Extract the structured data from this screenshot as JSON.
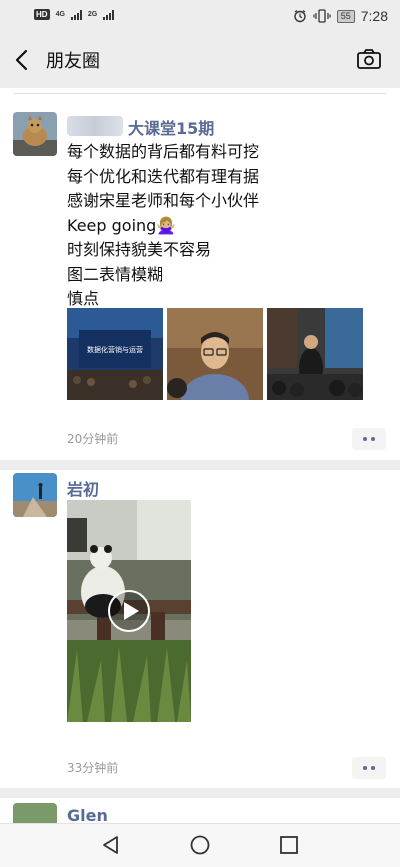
{
  "status_bar": {
    "hd_label": "HD",
    "net_label_1": "4G",
    "net_label_2": "2G",
    "battery": "55",
    "time": "7:28"
  },
  "nav": {
    "title": "朋友圈",
    "back_icon": "chevron-left-icon",
    "camera_icon": "camera-icon"
  },
  "posts": [
    {
      "name": "大课堂15期",
      "text_lines": [
        "每个数据的背后都有料可挖",
        "每个优化和迭代都有理有据",
        "感谢宋星老师和每个小伙伴",
        "Keep going🙅🏼‍♀️",
        "时刻保持貌美不容易",
        "图二表情模糊",
        "慎点"
      ],
      "image_1_caption": "数据化营销与运营",
      "time": "20分钟前"
    },
    {
      "name": "岩初",
      "time": "33分钟前",
      "media": "play-icon"
    },
    {
      "name": "Glen"
    }
  ],
  "bottom_nav": {
    "back_icon": "triangle-back-icon",
    "home_icon": "circle-home-icon",
    "recent_icon": "square-recent-icon"
  }
}
